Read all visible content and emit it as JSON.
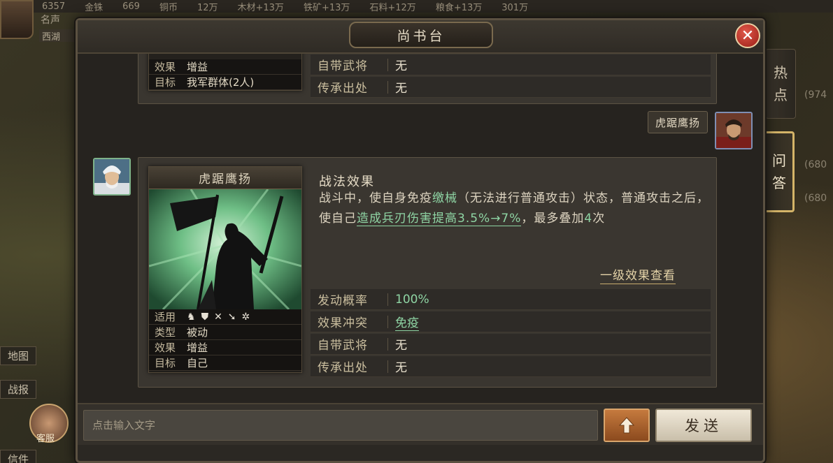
{
  "background": {
    "top_bar": [
      "6357",
      "金铢",
      "669",
      "铜币",
      "12万",
      "木材+13万",
      "铁矿+13万",
      "石料+12万",
      "粮食+13万",
      "301万"
    ],
    "player_name": "名声",
    "location": "西湖",
    "left_menu": [
      "地图",
      "战报",
      "信件"
    ],
    "customer_service": "客服",
    "map_labels": [
      "(974",
      "(680",
      "(680"
    ]
  },
  "modal": {
    "title": "尚书台",
    "close_icon": "close-icon"
  },
  "side_tabs": [
    {
      "label": "热\n点",
      "active": false
    },
    {
      "label": "问\n答",
      "active": true
    }
  ],
  "previous_card": {
    "info": [
      {
        "key": "效果",
        "value": "增益"
      },
      {
        "key": "目标",
        "value": "我军群体(2人)"
      }
    ],
    "rows": [
      {
        "key": "自带武将",
        "value": "无"
      },
      {
        "key": "传承出处",
        "value": "无"
      }
    ]
  },
  "user_message": {
    "text": "虎踞鹰扬"
  },
  "answer_card": {
    "skill_name": "虎踞鹰扬",
    "info": [
      {
        "key": "适用",
        "value": ""
      },
      {
        "key": "类型",
        "value": "被动"
      },
      {
        "key": "效果",
        "value": "增益"
      },
      {
        "key": "目标",
        "value": "自己"
      }
    ],
    "troop_icons": [
      "cavalry-icon",
      "shield-icon",
      "archer-icon",
      "spear-icon",
      "siege-icon"
    ],
    "effect_title": "战法效果",
    "effect_text": {
      "p1": "战斗中，使自身免疫",
      "g1": "缴械",
      "p2": "（无法进行普通攻击）状态，普通攻击之后，使自己",
      "g2": "造成兵刃伤害提高3.5%→7%",
      "p3": "，最多叠加",
      "g3": "4",
      "p4": "次"
    },
    "level_link": "一级效果查看",
    "rows": [
      {
        "key": "发动概率",
        "value": "100%",
        "green": true,
        "underline": false
      },
      {
        "key": "效果冲突",
        "value": "免疫",
        "green": true,
        "underline": true
      },
      {
        "key": "自带武将",
        "value": "无",
        "green": false,
        "underline": false
      },
      {
        "key": "传承出处",
        "value": "无",
        "green": false,
        "underline": false
      }
    ]
  },
  "input": {
    "placeholder": "点击输入文字",
    "up_icon": "arrow-up-icon",
    "send_label": "发送"
  }
}
